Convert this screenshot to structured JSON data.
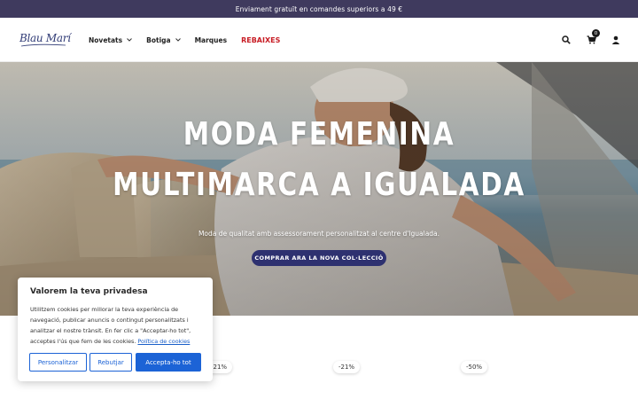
{
  "announcement": {
    "text": "Enviament gratuït en comandes superiors a 49 €"
  },
  "header": {
    "logo_text": "Blau Marí",
    "nav": [
      {
        "label": "Novetats",
        "has_dropdown": true
      },
      {
        "label": "Botiga",
        "has_dropdown": true
      },
      {
        "label": "Marques",
        "has_dropdown": false
      },
      {
        "label": "REBAIXES",
        "has_dropdown": false,
        "color": "#c81d25"
      }
    ],
    "icons": [
      "search-icon",
      "cart-icon",
      "account-icon"
    ],
    "cart_count": "0"
  },
  "hero": {
    "title_line1": "MODA FEMENINA",
    "title_line2": "MULTIMARCA A IGUALADA",
    "subtitle": "Moda de qualitat amb assessorament personalitzat al centre d'Igualada.",
    "cta": "COMPRAR ARA LA NOVA COL·LECCIÓ"
  },
  "products": {
    "badges": [
      "-21%",
      "-21%",
      "-50%"
    ]
  },
  "cookie": {
    "title": "Valorem la teva privadesa",
    "body": "Utilitzem cookies per millorar la teva experiència de navegació, publicar anuncis o contingut personalitzats i analitzar el nostre trànsit. En fer clic a \"Acceptar-ho tot\", acceptes l'ús que fem de les cookies.",
    "link": "Política de cookies",
    "buttons": {
      "customize": "Personalitzar",
      "reject": "Rebutjar",
      "accept": "Accepta-ho tot"
    }
  },
  "colors": {
    "announcement_bg": "#3f3a5e",
    "brand": "#2e3170",
    "sale": "#c81d25",
    "cookie_accent": "#1c63d6"
  }
}
